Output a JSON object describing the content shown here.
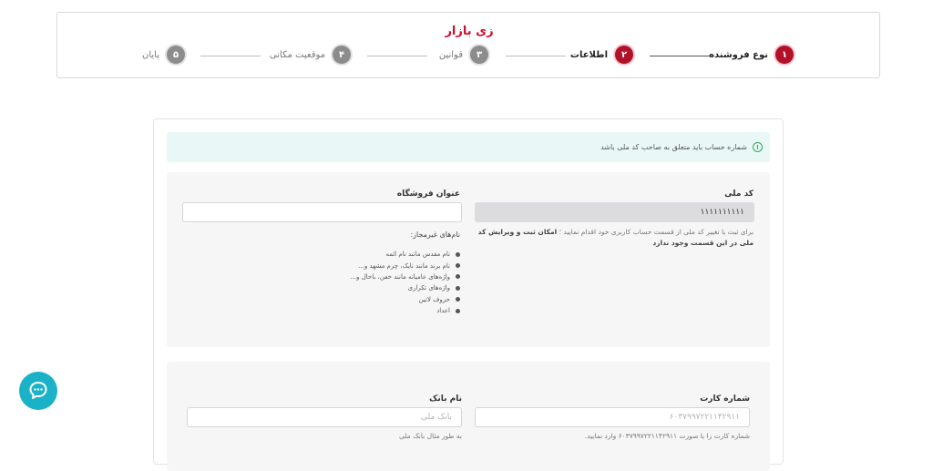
{
  "brand": {
    "logo_text": "زی بازار",
    "colors": {
      "primary": "#b3102a",
      "accent": "#f5a623",
      "chat": "#1bb2c8",
      "success": "#2eaa57"
    }
  },
  "stepper": [
    {
      "num": "۱",
      "label": "نوع فروشنده",
      "state": "active"
    },
    {
      "num": "۲",
      "label": "اطلاعات",
      "state": "active"
    },
    {
      "num": "۳",
      "label": "قوانین",
      "state": "inactive"
    },
    {
      "num": "۴",
      "label": "موقعیت مکانی",
      "state": "inactive"
    },
    {
      "num": "۵",
      "label": "پایان",
      "state": "inactive"
    }
  ],
  "alert": {
    "icon": "info-icon",
    "text": "شماره حساب باید متعلق به صاحب کد ملی باشد"
  },
  "national_code": {
    "label": "کد ملی",
    "value": "۱۱۱۱۱۱۱۱۱۱",
    "hint_normal": "برای ثبت یا تغییر کد ملی از قسمت حساب کاربری خود اقدام نمایید ؛",
    "hint_bold": "امکان ثبت و ویرایش کد ملی در این قسمت وجود ندارد"
  },
  "store_title": {
    "label": "عنوان فروشگاه",
    "value": "",
    "rules_title": "نام‌های غیرمجاز:",
    "rules": [
      "نام مقدس مانند نام ائمه",
      "نام برند مانند نایک، چرم مشهد و...",
      "واژه‌های عامیانه مانند خفن، باحال و...",
      "واژه‌های تکراری",
      "حروف لاتین",
      "اعداد"
    ]
  },
  "card_number": {
    "label": "شماره کارت",
    "placeholder": "۶۰۳۷۹۹۷۲۲۱۱۴۲۹۱۱",
    "hint": "شماره کارت را با صورت ۶۰۳۷۹۹۷۲۲۱۱۴۲۹۱۱ وارد نمایید."
  },
  "bank_name": {
    "label": "نام بانک",
    "placeholder": "بانک ملی",
    "hint": "به طور مثال بانک ملی"
  },
  "chat": {
    "icon": "chat-bubble-icon"
  }
}
